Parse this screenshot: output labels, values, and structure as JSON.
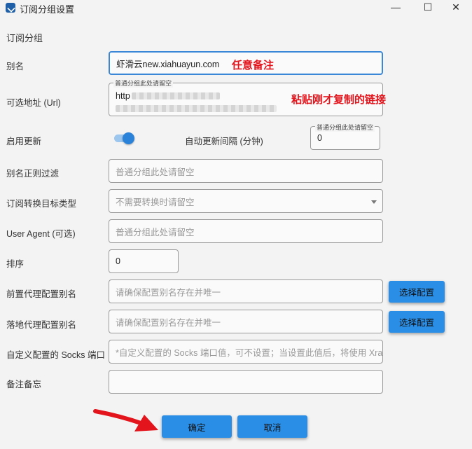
{
  "window": {
    "title": "订阅分组设置",
    "minimize": "—",
    "maximize": "☐",
    "close": "✕"
  },
  "section_title": "订阅分组",
  "form": {
    "alias": {
      "label": "别名",
      "value": "虾滑云new.xiahuayun.com",
      "note": "任意备注"
    },
    "url": {
      "label": "可选地址 (Url)",
      "hint": "普通分组此处请留空",
      "value_prefix": "http",
      "note": "粘贴刚才复制的链接"
    },
    "auto_update": {
      "label": "启用更新",
      "enabled": true
    },
    "interval": {
      "label": "自动更新间隔 (分钟)",
      "hint": "普通分组此处请留空",
      "value": "0"
    },
    "alias_regex": {
      "label": "别名正则过滤",
      "placeholder": "普通分组此处请留空"
    },
    "convert_type": {
      "label": "订阅转换目标类型",
      "placeholder": "不需要转换时请留空"
    },
    "user_agent": {
      "label": "User Agent (可选)",
      "placeholder": "普通分组此处请留空"
    },
    "sort": {
      "label": "排序",
      "value": "0"
    },
    "prev_proxy": {
      "label": "前置代理配置别名",
      "placeholder": "请确保配置别名存在并唯一",
      "button": "选择配置"
    },
    "next_proxy": {
      "label": "落地代理配置别名",
      "placeholder": "请确保配置别名存在并唯一",
      "button": "选择配置"
    },
    "socks_port": {
      "label": "自定义配置的 Socks 端口",
      "placeholder": "*自定义配置的 Socks 端口值，可不设置；当设置此值后，将使用 Xray"
    },
    "memo": {
      "label": "备注备忘",
      "value": ""
    }
  },
  "actions": {
    "ok": "确定",
    "cancel": "取消"
  },
  "colors": {
    "accent": "#2a8ee6",
    "annotation": "#e3141c",
    "focus_border": "#3a87d8"
  }
}
